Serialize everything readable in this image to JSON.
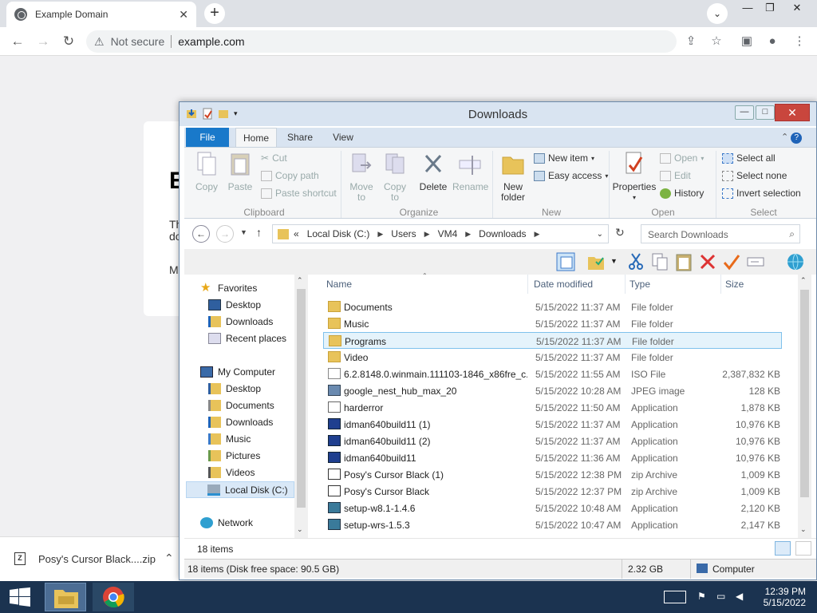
{
  "browser": {
    "tab_title": "Example Domain",
    "tab_close": "✕",
    "new_tab": "+",
    "security_label": "Not secure",
    "url": "example.com"
  },
  "page": {
    "heading": "E",
    "para1": "Th",
    "para2": "do",
    "para3": "M"
  },
  "download_bar": {
    "file": "Posy's Cursor Black....zip"
  },
  "explorer": {
    "title": "Downloads",
    "ribbon_tabs": [
      "File",
      "Home",
      "Share",
      "View"
    ],
    "clipboard": {
      "copy": "Copy",
      "paste": "Paste",
      "cut": "Cut",
      "copy_path": "Copy path",
      "paste_shortcut": "Paste shortcut",
      "label": "Clipboard"
    },
    "organize": {
      "move_to": "Move",
      "move_to2": "to",
      "copy_to": "Copy",
      "copy_to2": "to",
      "delete": "Delete",
      "rename": "Rename",
      "label": "Organize"
    },
    "new": {
      "new_folder": "New",
      "new_folder2": "folder",
      "new_item": "New item",
      "easy_access": "Easy access",
      "label": "New"
    },
    "open": {
      "properties": "Properties",
      "open": "Open",
      "edit": "Edit",
      "history": "History",
      "label": "Open"
    },
    "select": {
      "select_all": "Select all",
      "select_none": "Select none",
      "invert": "Invert selection",
      "label": "Select"
    },
    "address": {
      "prefix": "«",
      "parts": [
        "Local Disk (C:)",
        "Users",
        "VM4",
        "Downloads"
      ]
    },
    "search_placeholder": "Search Downloads",
    "nav": {
      "favorites": "Favorites",
      "fav_items": [
        "Desktop",
        "Downloads",
        "Recent places"
      ],
      "computer": "My Computer",
      "comp_items": [
        "Desktop",
        "Documents",
        "Downloads",
        "Music",
        "Pictures",
        "Videos",
        "Local Disk (C:)"
      ],
      "network": "Network"
    },
    "columns": {
      "name": "Name",
      "date": "Date modified",
      "type": "Type",
      "size": "Size"
    },
    "files": [
      {
        "name": "Documents",
        "date": "5/15/2022 11:37 AM",
        "type": "File folder",
        "size": "",
        "icon": "folder-icon"
      },
      {
        "name": "Music",
        "date": "5/15/2022 11:37 AM",
        "type": "File folder",
        "size": "",
        "icon": "folder-icon"
      },
      {
        "name": "Programs",
        "date": "5/15/2022 11:37 AM",
        "type": "File folder",
        "size": "",
        "icon": "folder-icon"
      },
      {
        "name": "Video",
        "date": "5/15/2022 11:37 AM",
        "type": "File folder",
        "size": "",
        "icon": "folder-icon"
      },
      {
        "name": "6.2.8148.0.winmain.111103-1846_x86fre_c...",
        "date": "5/15/2022 11:55 AM",
        "type": "ISO File",
        "size": "2,387,832 KB",
        "icon": "iso-icon"
      },
      {
        "name": "google_nest_hub_max_20",
        "date": "5/15/2022 10:28 AM",
        "type": "JPEG image",
        "size": "128 KB",
        "icon": "image-icon"
      },
      {
        "name": "harderror",
        "date": "5/15/2022 11:50 AM",
        "type": "Application",
        "size": "1,878 KB",
        "icon": "app-icon"
      },
      {
        "name": "idman640build11 (1)",
        "date": "5/15/2022 11:37 AM",
        "type": "Application",
        "size": "10,976 KB",
        "icon": "idm-icon"
      },
      {
        "name": "idman640build11 (2)",
        "date": "5/15/2022 11:37 AM",
        "type": "Application",
        "size": "10,976 KB",
        "icon": "idm-icon"
      },
      {
        "name": "idman640build11",
        "date": "5/15/2022 11:36 AM",
        "type": "Application",
        "size": "10,976 KB",
        "icon": "idm-icon"
      },
      {
        "name": "Posy's Cursor Black (1)",
        "date": "5/15/2022 12:38 PM",
        "type": "zip Archive",
        "size": "1,009 KB",
        "icon": "zip-icon"
      },
      {
        "name": "Posy's Cursor Black",
        "date": "5/15/2022 12:37 PM",
        "type": "zip Archive",
        "size": "1,009 KB",
        "icon": "zip-icon"
      },
      {
        "name": "setup-w8.1-1.4.6",
        "date": "5/15/2022 10:48 AM",
        "type": "Application",
        "size": "2,120 KB",
        "icon": "setup-icon"
      },
      {
        "name": "setup-wrs-1.5.3",
        "date": "5/15/2022 10:47 AM",
        "type": "Application",
        "size": "2,147 KB",
        "icon": "setup-icon"
      }
    ],
    "selected_row": 2,
    "items_count": "18 items",
    "status": {
      "left": "18 items (Disk free space: 90.5 GB)",
      "size": "2.32 GB",
      "location": "Computer"
    }
  },
  "taskbar": {
    "time": "12:39 PM",
    "date": "5/15/2022"
  }
}
